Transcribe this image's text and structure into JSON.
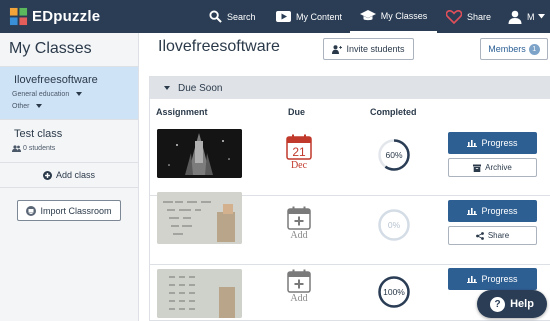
{
  "app": {
    "name": "EDpuzzle"
  },
  "nav": {
    "search": "Search",
    "content": "My Content",
    "classes": "My Classes",
    "share": "Share",
    "user_initial": "M"
  },
  "sidebar": {
    "title": "My Classes",
    "classes": [
      {
        "name": "Ilovefreesoftware",
        "subject": "General education",
        "grade": "Other"
      },
      {
        "name": "Test class",
        "students": "0 students"
      }
    ],
    "add_class": "Add class",
    "import": "Import Classroom"
  },
  "main": {
    "class_title": "Ilovefreesoftware",
    "invite": "Invite students",
    "members": "Members",
    "members_count": "1",
    "section": "Due Soon",
    "columns": {
      "assignment": "Assignment",
      "due": "Due",
      "completed": "Completed"
    },
    "rows": [
      {
        "due_day": "21",
        "due_month": "Dec",
        "completed": "60%",
        "completed_value": 60,
        "primary": "Progress",
        "secondary": "Archive"
      },
      {
        "due_label": "Add",
        "completed": "0%",
        "completed_value": 0,
        "primary": "Progress",
        "secondary": "Share"
      },
      {
        "due_label": "Add",
        "completed": "100%",
        "completed_value": 100,
        "primary": "Progress"
      }
    ]
  },
  "help": "Help",
  "colors": {
    "topbar": "#2a3d55",
    "accent": "#2e5f93",
    "due_red": "#c0392b",
    "active_class": "#cfe3f7"
  }
}
